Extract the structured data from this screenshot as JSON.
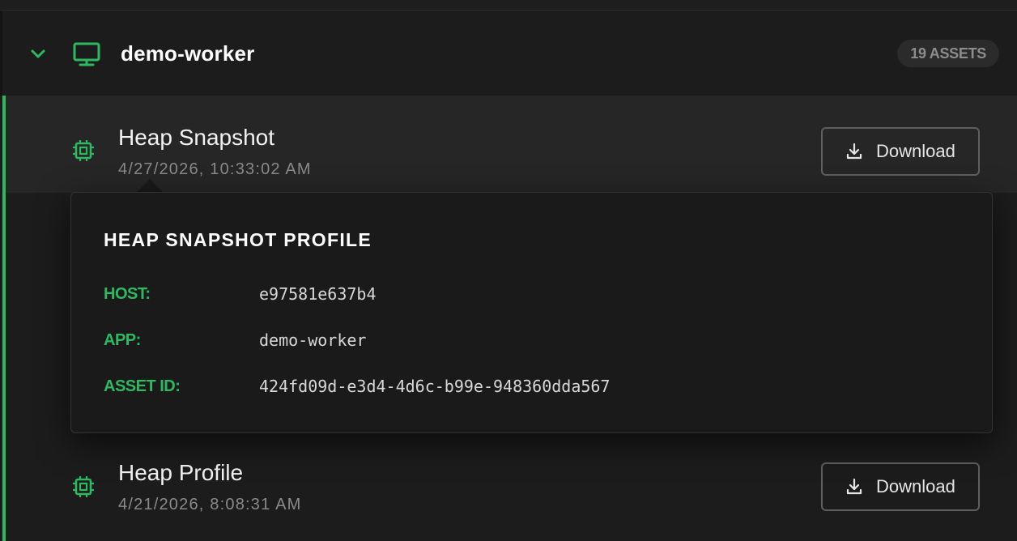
{
  "group": {
    "title": "demo-worker",
    "assets_badge": "19 ASSETS",
    "chevron_icon": "chevron-down-icon",
    "device_icon": "monitor-icon"
  },
  "assets": [
    {
      "title": "Heap Snapshot",
      "date": "4/27/2026, 10:33:02 AM",
      "icon": "chip-icon",
      "download_label": "Download"
    },
    {
      "title": "Heap Profile",
      "date": "4/21/2026, 8:08:31 AM",
      "icon": "chip-icon",
      "download_label": "Download"
    }
  ],
  "tooltip": {
    "title": "HEAP SNAPSHOT PROFILE",
    "fields": [
      {
        "label": "HOST:",
        "value": "e97581e637b4"
      },
      {
        "label": "APP:",
        "value": "demo-worker"
      },
      {
        "label": "ASSET ID:",
        "value": "424fd09d-e3d4-4d6c-b99e-948360dda567"
      }
    ]
  },
  "colors": {
    "accent": "#2fb862",
    "background": "#1c1c1c",
    "active_row": "#262626",
    "tooltip_bg": "#1a1a1a"
  }
}
